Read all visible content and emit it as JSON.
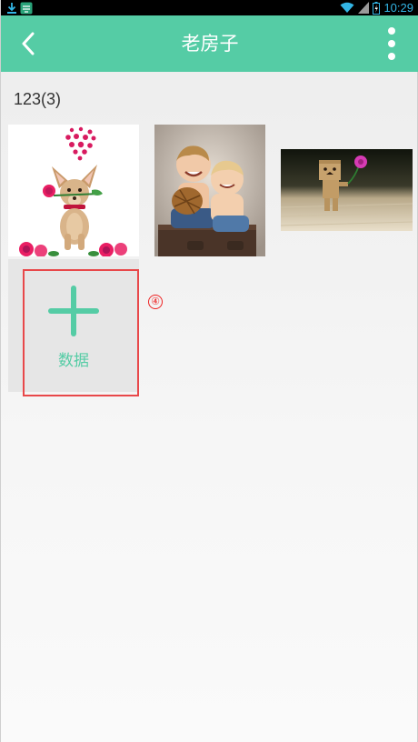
{
  "status_bar": {
    "time": "10:29",
    "icons": [
      "download-icon",
      "notification-icon",
      "wifi-icon",
      "signal-icon",
      "battery-icon"
    ]
  },
  "app_bar": {
    "title": "老房子",
    "back_icon": "chevron-left-icon",
    "menu_icon": "more-vertical-icon"
  },
  "album": {
    "title": "123(3)",
    "photos": [
      {
        "subject": "chihuahua-with-rose"
      },
      {
        "subject": "two-kids-laughing"
      },
      {
        "subject": "danbo-with-flower"
      }
    ],
    "add_tile": {
      "icon": "plus-icon",
      "label": "数据"
    }
  },
  "annotation": {
    "marker": "④",
    "color": "#e8484a"
  },
  "colors": {
    "accent": "#55cca5",
    "status_bar_bg": "#000000",
    "status_icon": "#33b5e5"
  }
}
